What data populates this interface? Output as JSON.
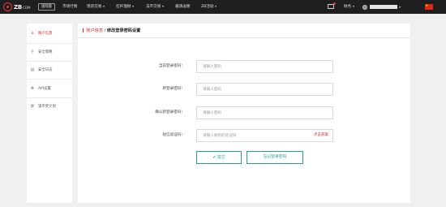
{
  "header": {
    "logo_text": "ZB",
    "logo_domain": "COM",
    "intl_label": "国际版",
    "nav": [
      {
        "label": "市场行情",
        "has_menu": false
      },
      {
        "label": "现货交易",
        "has_menu": true
      },
      {
        "label": "杠杆理财",
        "has_menu": true
      },
      {
        "label": "法币交易",
        "has_menu": true
      },
      {
        "label": "邀请返佣",
        "has_menu": false
      },
      {
        "label": "ZB活动",
        "has_menu": true
      }
    ],
    "finance_label": "财务",
    "icons": {
      "messages": "mail-icon",
      "flag": "china-flag-icon"
    },
    "accent_color": "#e03a2f"
  },
  "sidebar": {
    "items": [
      {
        "label": "账户信息",
        "icon": "home-icon",
        "active": true
      },
      {
        "label": "安全策略",
        "icon": "location-pin-icon",
        "active": false
      },
      {
        "label": "安全日志",
        "icon": "log-icon",
        "active": false
      },
      {
        "label": "API设置",
        "icon": "api-icon",
        "active": false
      },
      {
        "label": "锁币奖计划",
        "icon": "lock-icon",
        "active": false
      }
    ],
    "active_color": "#d9242b"
  },
  "main": {
    "breadcrumb": {
      "parent": "账户信息",
      "separator": "/",
      "current": "修改登录密码设置"
    },
    "form": {
      "current_password": {
        "label": "当前登录密码：",
        "placeholder": "请输入密码",
        "value": ""
      },
      "new_password": {
        "label": "新登录密码：",
        "placeholder": "请输入密码",
        "value": ""
      },
      "confirm_password": {
        "label": "确认新登录密码：",
        "placeholder": "请输入密码",
        "value": ""
      },
      "sms_code": {
        "label": "短信验证码：",
        "placeholder": "请输入收到的验证码",
        "value": "",
        "get_code_label": "点击获取"
      }
    },
    "buttons": {
      "submit_label": "提交",
      "forgot_label": "忘记登录密码"
    },
    "button_color": "#2a9d8f"
  }
}
